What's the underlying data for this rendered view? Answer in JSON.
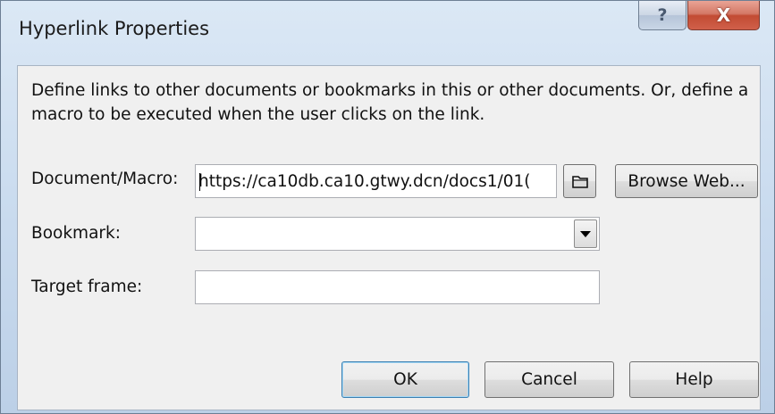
{
  "window": {
    "title": "Hyperlink Properties",
    "help_glyph": "?",
    "close_glyph": "X"
  },
  "description": "Define links to other documents or bookmarks in this or other documents. Or, define a macro to be executed when the user clicks on the link.",
  "form": {
    "document_macro_label": "Document/Macro:",
    "document_macro_value": "https://ca10db.ca10.gtwy.dcn/docs1/01(",
    "bookmark_label": "Bookmark:",
    "bookmark_value": "",
    "target_frame_label": "Target frame:",
    "target_frame_value": ""
  },
  "buttons": {
    "browse_folder_icon": "folder-icon",
    "browse_web": "Browse Web...",
    "ok": "OK",
    "cancel": "Cancel",
    "help": "Help"
  }
}
